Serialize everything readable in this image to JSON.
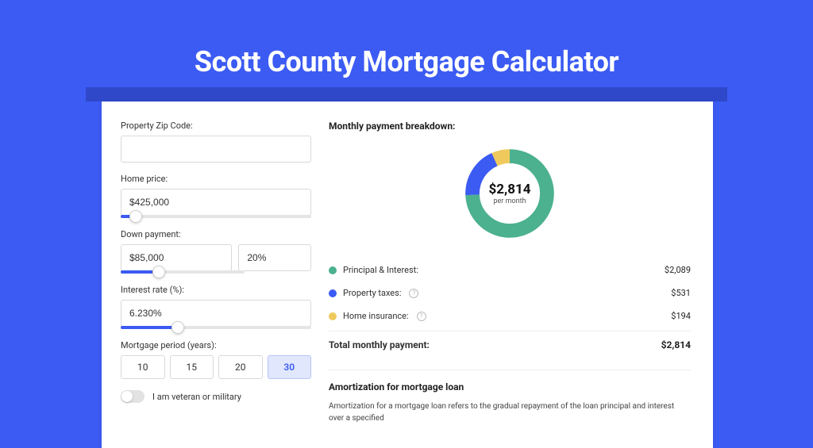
{
  "page": {
    "title": "Scott County Mortgage Calculator"
  },
  "form": {
    "zip": {
      "label": "Property Zip Code:",
      "value": ""
    },
    "home_price": {
      "label": "Home price:",
      "value": "$425,000",
      "slider_pct": 8
    },
    "down_payment": {
      "label": "Down payment:",
      "amount": "$85,000",
      "percent": "20%",
      "slider_pct": 20
    },
    "interest_rate": {
      "label": "Interest rate (%):",
      "value": "6.230%",
      "slider_pct": 30
    },
    "period": {
      "label": "Mortgage period (years):",
      "options": [
        "10",
        "15",
        "20",
        "30"
      ],
      "selected": "30"
    },
    "veteran": {
      "label": "I am veteran or military",
      "on": false
    }
  },
  "breakdown": {
    "title": "Monthly payment breakdown:",
    "center_value": "$2,814",
    "center_sub": "per month",
    "items": [
      {
        "label": "Principal & Interest:",
        "amount": "$2,089",
        "info": false
      },
      {
        "label": "Property taxes:",
        "amount": "$531",
        "info": true
      },
      {
        "label": "Home insurance:",
        "amount": "$194",
        "info": true
      }
    ],
    "total": {
      "label": "Total monthly payment:",
      "amount": "$2,814"
    }
  },
  "amortization": {
    "title": "Amortization for mortgage loan",
    "text": "Amortization for a mortgage loan refers to the gradual repayment of the loan principal and interest over a specified"
  },
  "chart_data": {
    "type": "pie",
    "title": "Monthly payment breakdown",
    "series": [
      {
        "name": "Principal & Interest",
        "value": 2089,
        "color": "#4bb18f"
      },
      {
        "name": "Property taxes",
        "value": 531,
        "color": "#3c5bf3"
      },
      {
        "name": "Home insurance",
        "value": 194,
        "color": "#f0c95d"
      }
    ],
    "total": 2814,
    "donut": true,
    "donut_width": 18
  }
}
